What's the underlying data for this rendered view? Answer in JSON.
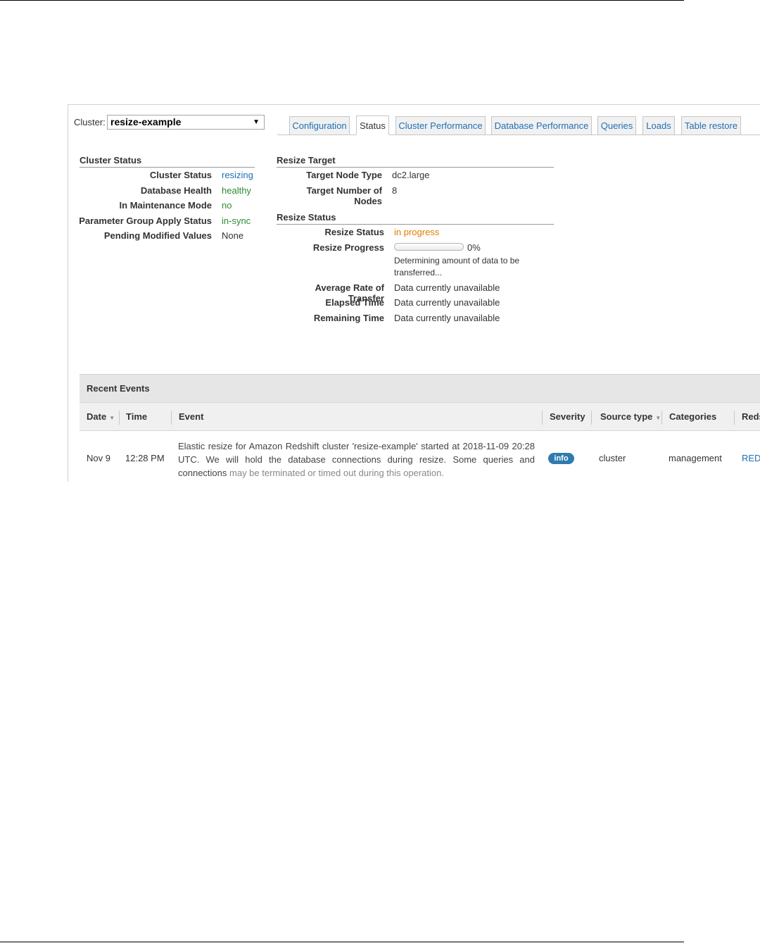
{
  "cluster": {
    "label": "Cluster:",
    "selected": "resize-example"
  },
  "tabs": [
    {
      "label": "Configuration",
      "active": false
    },
    {
      "label": "Status",
      "active": true
    },
    {
      "label": "Cluster Performance",
      "active": false
    },
    {
      "label": "Database Performance",
      "active": false
    },
    {
      "label": "Queries",
      "active": false
    },
    {
      "label": "Loads",
      "active": false
    },
    {
      "label": "Table restore",
      "active": false
    }
  ],
  "cluster_status": {
    "heading": "Cluster Status",
    "rows": [
      {
        "key": "Cluster Status",
        "value": "resizing"
      },
      {
        "key": "Database Health",
        "value": "healthy"
      },
      {
        "key": "In Maintenance Mode",
        "value": "no"
      },
      {
        "key": "Parameter Group Apply Status",
        "value": "in-sync"
      },
      {
        "key": "Pending Modified Values",
        "value": "None"
      }
    ]
  },
  "resize_target": {
    "heading": "Resize Target",
    "rows": [
      {
        "key": "Target Node Type",
        "value": "dc2.large"
      },
      {
        "key": "Target Number of Nodes",
        "value": "8"
      }
    ]
  },
  "resize_status": {
    "heading": "Resize Status",
    "status_key": "Resize Status",
    "status_value": "in progress",
    "progress_key": "Resize Progress",
    "progress_percent": 0,
    "progress_label": "0%",
    "progress_note": "Determining amount of data to be transferred...",
    "rows": [
      {
        "key": "Average Rate of Transfer",
        "value": "Data currently unavailable"
      },
      {
        "key": "Elapsed Time",
        "value": "Data currently unavailable"
      },
      {
        "key": "Remaining Time",
        "value": "Data currently unavailable"
      }
    ]
  },
  "events": {
    "heading": "Recent Events",
    "columns": [
      "Date",
      "Time",
      "Event",
      "Severity",
      "Source type",
      "Categories",
      "Reds"
    ],
    "rows": [
      {
        "date": "Nov 9",
        "time": "12:28 PM",
        "event_main": "Elastic resize for Amazon Redshift cluster 'resize-example' started at 2018-11-09 20:28 UTC. We will hold the database connections during resize. Some queries and connections",
        "event_faded": "may be terminated or timed out during this operation.",
        "severity": "info",
        "source_type": "cluster",
        "categories": "management",
        "link": "RED"
      }
    ]
  },
  "colors": {
    "link": "#1f6fb5",
    "healthy": "#2e8b2e",
    "in_progress": "#e07b00",
    "badge": "#2f7bb0"
  }
}
